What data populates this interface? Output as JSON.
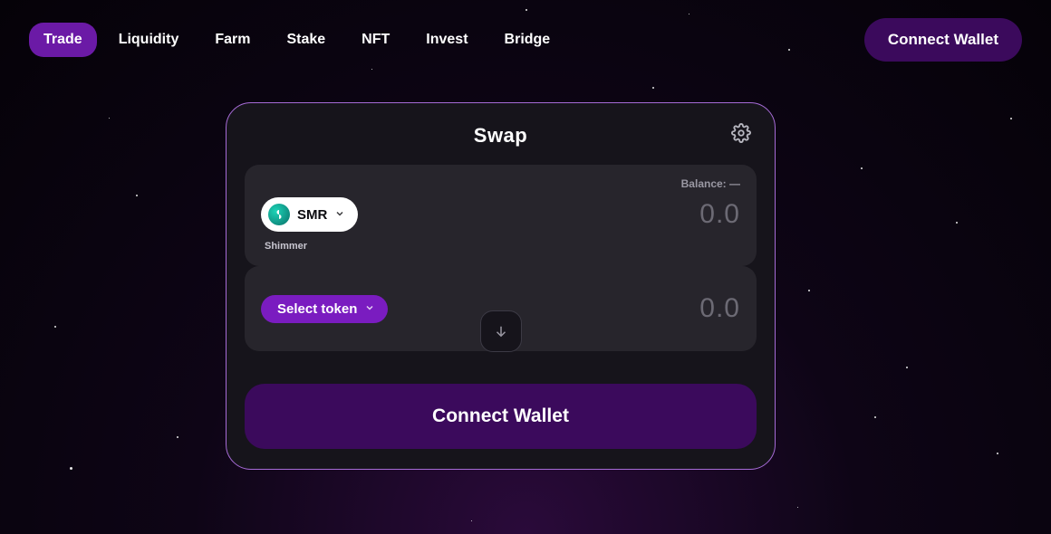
{
  "nav": {
    "items": [
      "Trade",
      "Liquidity",
      "Farm",
      "Stake",
      "NFT",
      "Invest",
      "Bridge"
    ],
    "active_index": 0
  },
  "header": {
    "connect_label": "Connect Wallet"
  },
  "swap": {
    "title": "Swap",
    "from": {
      "balance_label": "Balance: —",
      "token_symbol": "SMR",
      "token_name": "Shimmer",
      "amount": "0.0"
    },
    "to": {
      "select_token_label": "Select token",
      "amount": "0.0"
    },
    "connect_label": "Connect Wallet"
  }
}
